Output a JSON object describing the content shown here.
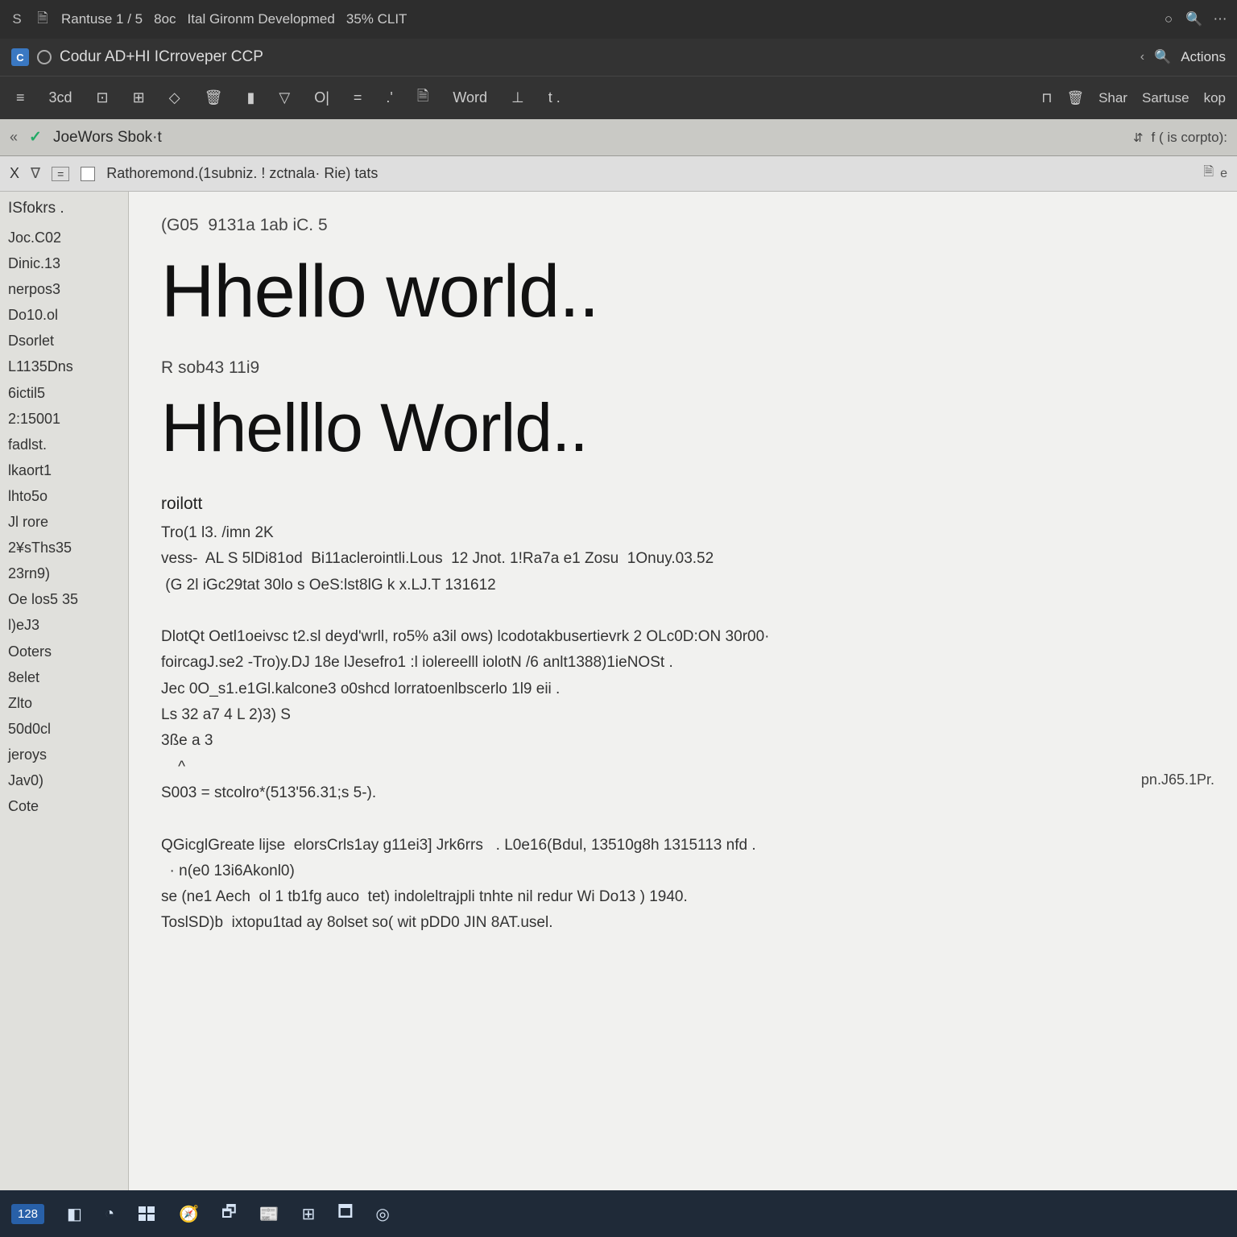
{
  "titlebar": {
    "items": [
      "S",
      "Rantuse 1 / 5",
      "8oc",
      "Ital Gironm Developmed",
      "35% CLIT"
    ],
    "right": [
      "○",
      "🔍",
      "⋯"
    ]
  },
  "menubar": {
    "app": "C",
    "title": "Codur  AD+HI ICrroveper CCP",
    "chevron": "‹",
    "search_icon": "🔍",
    "action": "Actions"
  },
  "toolbar": {
    "items": [
      "≡",
      "3cd",
      "⊡",
      "⊞",
      "◇",
      "🗑",
      "▮",
      "▽",
      "O|",
      "=",
      ".'",
      "🗎",
      "Word",
      "⊥",
      "t ."
    ],
    "right": [
      "⊓",
      "🗑",
      "Shar",
      "Sartuse",
      "kop"
    ]
  },
  "tabstrip": {
    "chev": "«",
    "check": "✓",
    "label": "JoeWors Sbok·t",
    "right_pin": "⇵",
    "right_text": "f ( is corpto):"
  },
  "pathbar": {
    "close": "X",
    "funnel": "∇",
    "eq": "=",
    "breadcrumb": "Rathoremond.(1subniz. ! zctnala·  Rie) tats",
    "right_icon": "🗎",
    "right_text": "e"
  },
  "sidebar": {
    "head": "ISfokrs .",
    "items": [
      "Joc.C02",
      "Dinic.13",
      "nerpos3",
      " ",
      "Do10.ol",
      "Dsorlet",
      "L1135Dns",
      "6ictil5",
      "2:15001",
      "fadlst.",
      "lkaort1",
      "lhto5o",
      "Jl rore",
      "2¥sThs35",
      "23rn9)",
      "Oe los5 35",
      "l)eJ3",
      "Ooters",
      "8elet",
      "Zlto",
      "50d0cl",
      "jeroys",
      "Jav0)",
      "Cote"
    ]
  },
  "editor": {
    "comment_line": "(G05  9131a 1ab iC. 5",
    "heading1": "Hhello  world..",
    "label1": "R sob43 11i9",
    "heading2": "Hhelllo  World..",
    "section_head": "roilott",
    "lines": [
      "Tro(1 l3. /imn 2K",
      "vess-  AL S 5lDi81od  Bi11aclerointli.Lous  12 Jnot. 1!Ra7a e1 Zosu  1Onuy.03.52",
      " (G 2l iGc29tat 30lo s OeS:lst8lG k x.LJ.T 131612",
      "",
      "DlotQt Oetl1oeivsc t2.sl deyd'wrll, ro5% a3il ows) lcodotakbusertievrk 2 OLc0D:ON 30r00·",
      "foircagJ.se2 -Tro)y.DJ 18e lJesefro1 :l iolereelll iolotN /6 anlt1388)1ieNOSt .",
      "Jec 0O_s1.e1Gl.kalcone3 o0shcd lorratoenlbscerlo 1l9 eii .",
      "Ls 32 a7 4 L 2)3) S",
      "3ße a 3",
      "    ^",
      "S003 = stcolro*(513'56.31;s 5-).",
      "",
      "QGicglGreate lijse  elorsCrls1ay g11ei3] Jrk6rrs   . L0e16(Bdul, 13510g8h 1315113 nfd .",
      "  · n(e0 13i6Akonl0)",
      "se (ne1 Aech  ol 1 tb1fg auco  tet) indoleltrajpli tnhte nil redur Wi Do13 ) 1940.",
      "ToslSD)b  ixtopu1tad ay 8olset so( wit pDD0 JIN 8AT.usel."
    ],
    "side_note": "pn.J65.1Pr."
  },
  "taskbar": {
    "badge": "128",
    "items": [
      "◧",
      "◔",
      "🧭",
      "🗗",
      "📰",
      "⊞",
      "🗖",
      "◎"
    ]
  }
}
